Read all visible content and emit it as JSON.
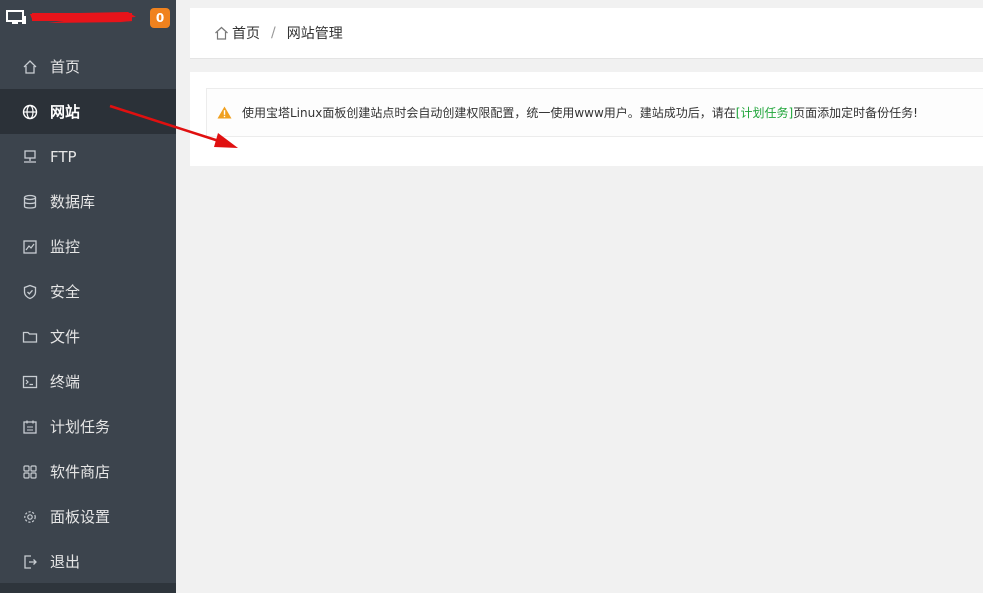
{
  "sidebar": {
    "badge_count": "0",
    "items": [
      {
        "label": "首页",
        "icon": "home-icon"
      },
      {
        "label": "网站",
        "icon": "globe-icon",
        "active": true
      },
      {
        "label": "FTP",
        "icon": "ftp-network-icon"
      },
      {
        "label": "数据库",
        "icon": "database-icon"
      },
      {
        "label": "监控",
        "icon": "monitor-chart-icon"
      },
      {
        "label": "安全",
        "icon": "shield-icon"
      },
      {
        "label": "文件",
        "icon": "folder-icon"
      },
      {
        "label": "终端",
        "icon": "terminal-icon"
      },
      {
        "label": "计划任务",
        "icon": "calendar-icon"
      },
      {
        "label": "软件商店",
        "icon": "grid-apps-icon"
      },
      {
        "label": "面板设置",
        "icon": "gear-icon"
      },
      {
        "label": "退出",
        "icon": "logout-icon"
      }
    ]
  },
  "breadcrumb": {
    "home": "首页",
    "separator": "/",
    "current": "网站管理"
  },
  "alert": {
    "text_before": "使用宝塔Linux面板创建站点时会自动创建权限配置，统一使用www用户。建站成功后，请在",
    "link": "[计划任务]",
    "text_after": "页面添加定时备份任务!"
  },
  "colors": {
    "sidebar_bg": "#3c444d",
    "sidebar_active_bg": "#2b3138",
    "badge": "#f0821e",
    "link_green": "#20a53a",
    "warning_orange": "#f0a020",
    "annotation_red": "#e01010"
  }
}
